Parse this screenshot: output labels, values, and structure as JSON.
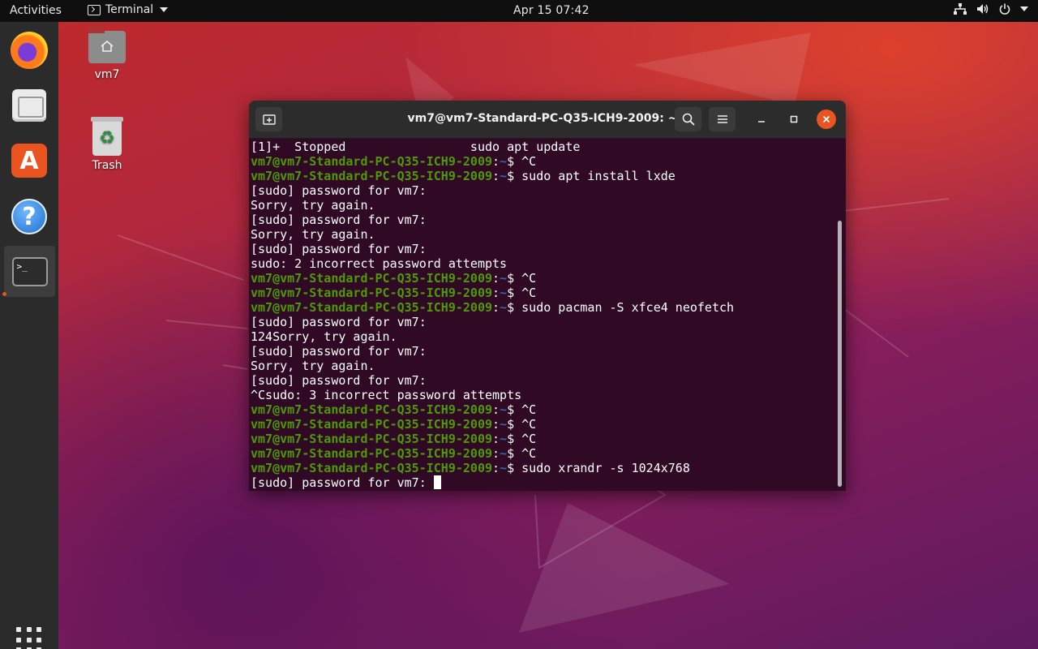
{
  "topbar": {
    "activities": "Activities",
    "app_name": "Terminal",
    "clock": "Apr 15  07:42",
    "tray_icons": [
      "network-icon",
      "volume-icon",
      "power-icon",
      "chevron-down-icon"
    ]
  },
  "dock": {
    "items": [
      {
        "name": "firefox",
        "icon": "firefox-icon"
      },
      {
        "name": "files",
        "icon": "files-icon"
      },
      {
        "name": "ubuntu-software",
        "icon": "software-store-icon"
      },
      {
        "name": "help",
        "icon": "help-icon",
        "glyph": "?"
      },
      {
        "name": "terminal",
        "icon": "terminal-icon",
        "glyph": ">_",
        "active": true
      }
    ],
    "apps_grid_icon": "show-applications-icon"
  },
  "desktop": {
    "icons": [
      {
        "label": "vm7",
        "icon": "home-folder-icon"
      },
      {
        "label": "Trash",
        "icon": "trash-icon"
      }
    ]
  },
  "terminal": {
    "title": "vm7@vm7-Standard-PC-Q35-ICH9-2009: ~",
    "prompt_user": "vm7@vm7-Standard-PC-Q35-ICH9-2009",
    "prompt_path": "~",
    "lines": [
      {
        "type": "output",
        "text": "[1]+  Stopped                 sudo apt update"
      },
      {
        "type": "prompt",
        "cmd": "^C"
      },
      {
        "type": "prompt",
        "cmd": "sudo apt install lxde"
      },
      {
        "type": "output",
        "text": "[sudo] password for vm7:"
      },
      {
        "type": "output",
        "text": "Sorry, try again."
      },
      {
        "type": "output",
        "text": "[sudo] password for vm7:"
      },
      {
        "type": "output",
        "text": "Sorry, try again."
      },
      {
        "type": "output",
        "text": "[sudo] password for vm7:"
      },
      {
        "type": "output",
        "text": "sudo: 2 incorrect password attempts"
      },
      {
        "type": "prompt",
        "cmd": "^C"
      },
      {
        "type": "prompt",
        "cmd": "^C"
      },
      {
        "type": "prompt",
        "cmd": "sudo pacman -S xfce4 neofetch"
      },
      {
        "type": "output",
        "text": "[sudo] password for vm7:"
      },
      {
        "type": "output",
        "text": "124Sorry, try again."
      },
      {
        "type": "output",
        "text": "[sudo] password for vm7:"
      },
      {
        "type": "output",
        "text": "Sorry, try again."
      },
      {
        "type": "output",
        "text": "[sudo] password for vm7:"
      },
      {
        "type": "output",
        "text": "^Csudo: 3 incorrect password attempts"
      },
      {
        "type": "prompt",
        "cmd": "^C"
      },
      {
        "type": "prompt",
        "cmd": "^C"
      },
      {
        "type": "prompt",
        "cmd": "^C"
      },
      {
        "type": "prompt",
        "cmd": "^C"
      },
      {
        "type": "prompt",
        "cmd": "sudo xrandr -s 1024x768"
      },
      {
        "type": "output",
        "text": "[sudo] password for vm7: ",
        "cursor": true
      }
    ]
  },
  "colors": {
    "terminal_bg": "#300a24",
    "prompt_user": "#4e9a06",
    "prompt_path": "#3465a4",
    "close_button": "#e95420",
    "titlebar": "#2c2c2c"
  }
}
